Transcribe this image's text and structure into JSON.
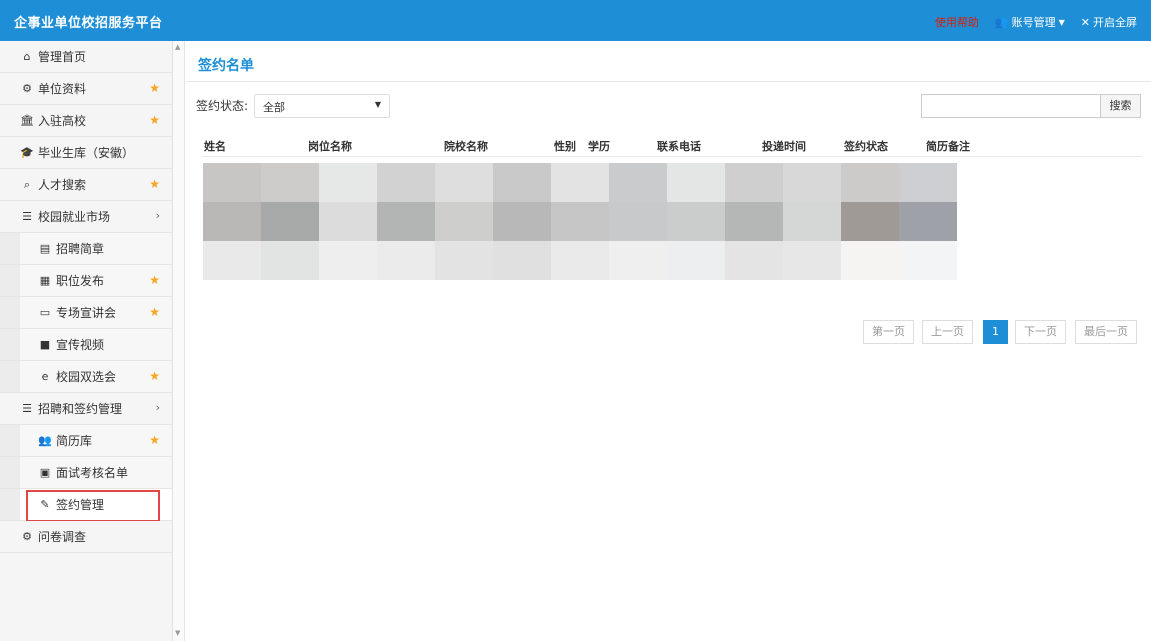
{
  "app": {
    "title": "企事业单位校招服务平台",
    "help": "使用帮助",
    "account": "账号管理",
    "fullscreen": "开启全屏"
  },
  "sidebar": {
    "items": [
      {
        "label": "管理首页",
        "icon": "home-icon",
        "star": false
      },
      {
        "label": "单位资料",
        "icon": "gear-icon",
        "star": true
      },
      {
        "label": "入驻高校",
        "icon": "bank-icon",
        "star": true
      },
      {
        "label": "毕业生库（安徽）",
        "icon": "graduation-cap-icon",
        "star": false
      },
      {
        "label": "人才搜索",
        "icon": "search-icon",
        "star": true
      },
      {
        "label": "校园就业市场",
        "icon": "list-icon",
        "chevron": true
      },
      {
        "label": "招聘简章",
        "icon": "file-icon",
        "sub": true
      },
      {
        "label": "职位发布",
        "icon": "grid-icon",
        "sub": true,
        "star": true
      },
      {
        "label": "专场宣讲会",
        "icon": "screen-icon",
        "sub": true,
        "star": true
      },
      {
        "label": "宣传视频",
        "icon": "video-icon",
        "sub": true
      },
      {
        "label": "校园双选会",
        "icon": "ie-icon",
        "sub": true,
        "star": true
      },
      {
        "label": "招聘和签约管理",
        "icon": "list-icon",
        "chevron": true
      },
      {
        "label": "简历库",
        "icon": "users-icon",
        "sub": true,
        "star": true
      },
      {
        "label": "面试考核名单",
        "icon": "calendar-icon",
        "sub": true
      },
      {
        "label": "签约管理",
        "icon": "edit-icon",
        "sub": true,
        "active": true
      },
      {
        "label": "问卷调查",
        "icon": "gear-icon"
      }
    ]
  },
  "main": {
    "title": "签约名单",
    "filter_label": "签约状态:",
    "filter_value": "全部",
    "search_button": "搜索",
    "columns": [
      "姓名",
      "岗位名称",
      "院校名称",
      "性别",
      "学历",
      "联系电话",
      "投递时间",
      "签约状态",
      "简历备注"
    ]
  },
  "pagination": {
    "first": "第一页",
    "prev": "上一页",
    "current": "1",
    "next": "下一页",
    "last": "最后一页"
  },
  "colors": {
    "brand": "#1e8fd6",
    "help": "#d81e06",
    "star": "#f5a623",
    "active_outline": "#e04646"
  }
}
